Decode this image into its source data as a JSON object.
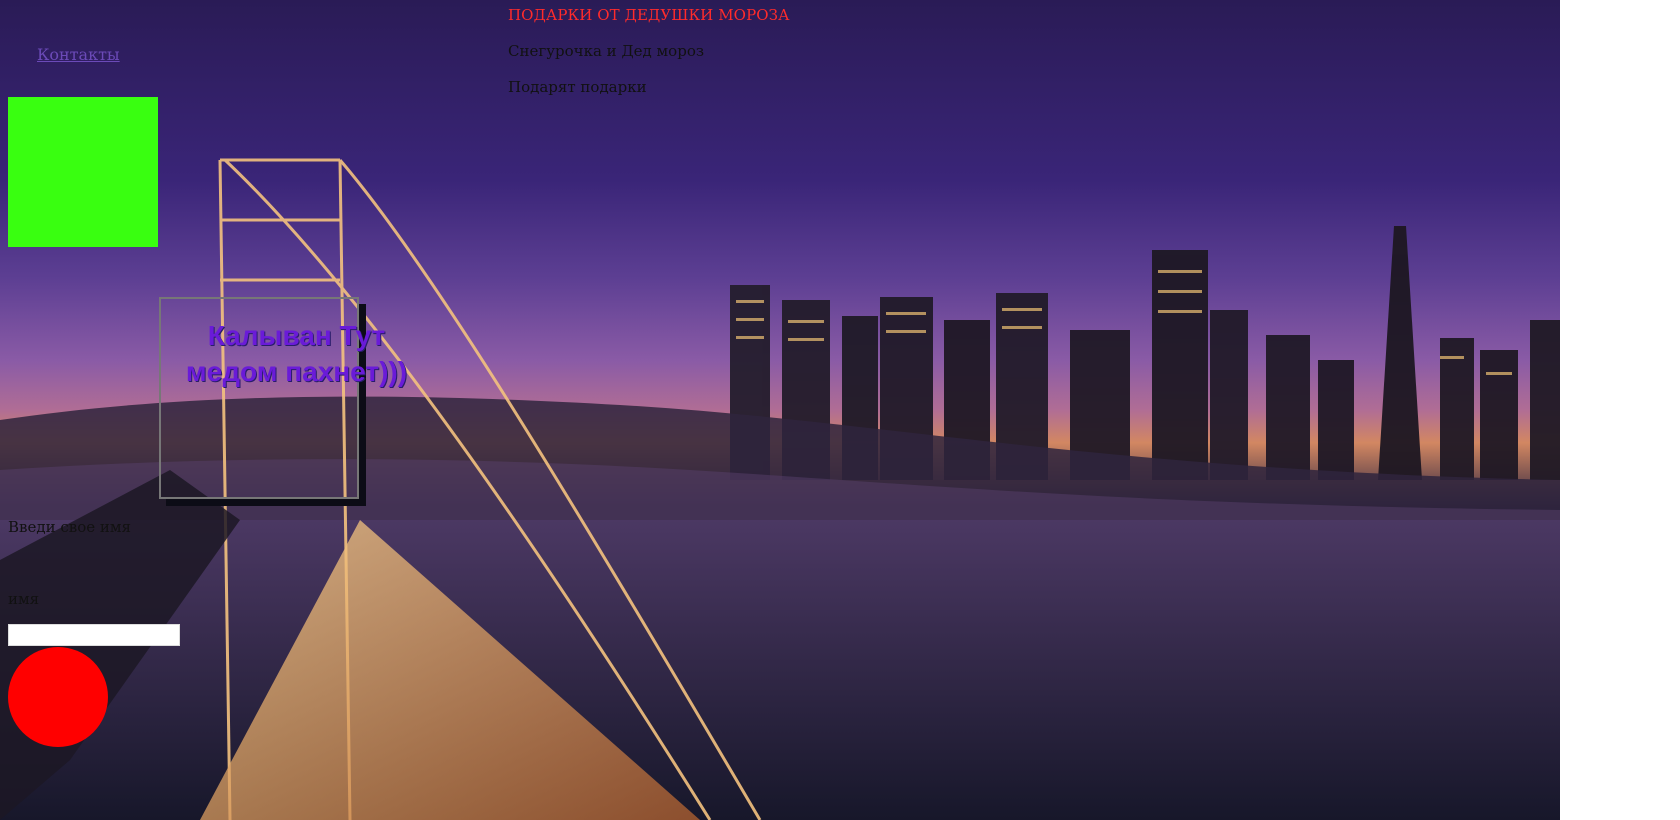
{
  "nav": {
    "contacts_link": "Контакты"
  },
  "header": {
    "title": "ПОДАРКИ ОТ ДЕДУШКИ МОРОЗА",
    "line1": "Снегурочка и Дед мороз",
    "line2": "Подарят подарки"
  },
  "feature": {
    "title": "Калыван Тут медом пахнет)))"
  },
  "form": {
    "caption": "Введи свое имя",
    "label": "имя",
    "value": "",
    "placeholder": ""
  },
  "colors": {
    "heading": "#ff2b2b",
    "link": "#6b4ab8",
    "green_box": "#39ff10",
    "red_circle": "#ff0000",
    "feature_text": "#6a1bd8"
  }
}
